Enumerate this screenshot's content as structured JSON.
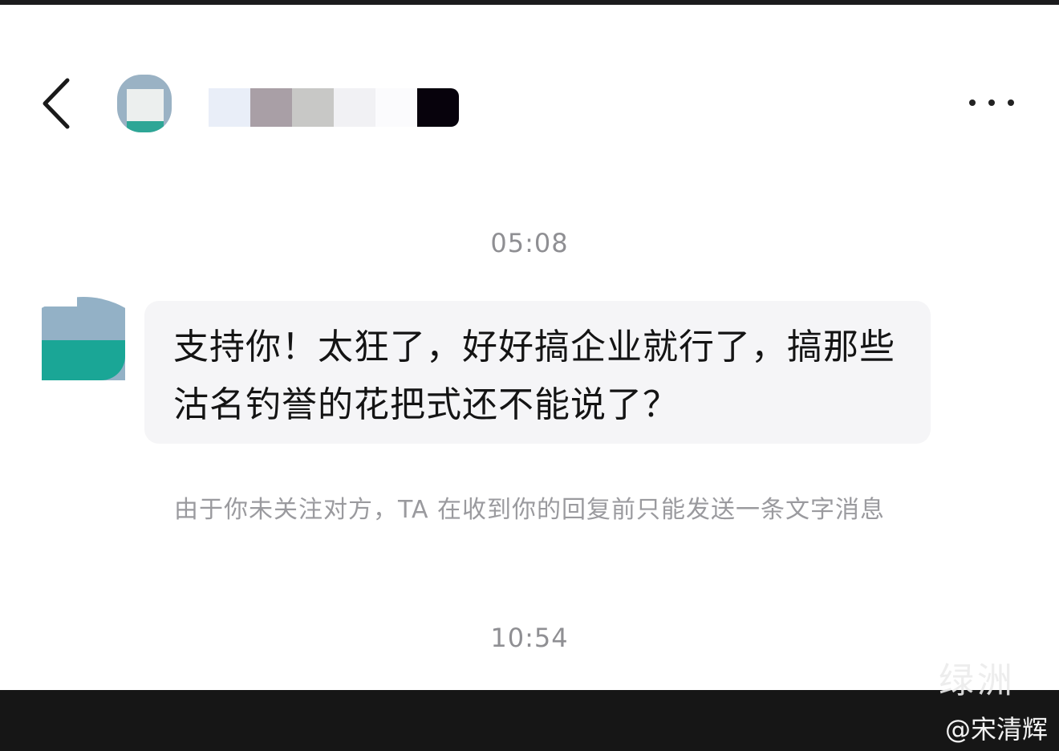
{
  "header": {
    "contact_name_masked": true,
    "name_mosaic_colors": [
      "#e9eef8",
      "#a99fa6",
      "#c8c8c6",
      "#f1f1f4",
      "#fbfbfd",
      "#07020c"
    ],
    "back_icon": "chevron-left-icon",
    "more_icon": "more-horizontal-icon"
  },
  "conversation": {
    "timestamp_1": "05:08",
    "message": {
      "text": "支持你！太狂了，好好搞企业就行了，搞那些沽名钓誉的花把式还不能说了？"
    },
    "system_notice": "由于你未关注对方，TA 在收到你的回复前只能发送一条文字消息",
    "timestamp_2": "10:54"
  },
  "watermark": {
    "logo_text": "绿洲",
    "handle": "@宋清辉"
  },
  "colors": {
    "bubble_background": "#f5f5f7",
    "timestamp_text": "#8f8f93",
    "bottom_bar": "#161616"
  }
}
